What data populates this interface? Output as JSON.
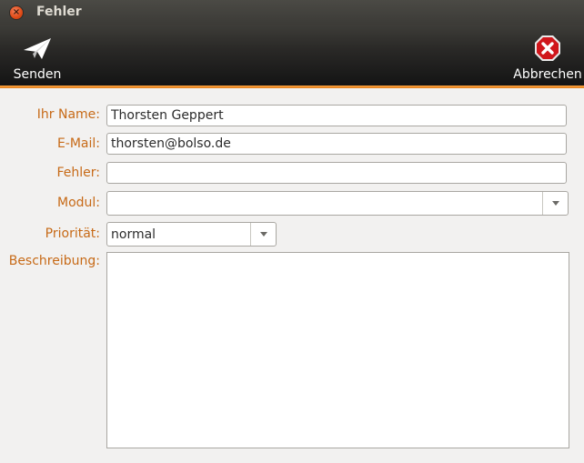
{
  "window": {
    "title": "Fehler"
  },
  "toolbar": {
    "send_label": "Senden",
    "cancel_label": "Abbrechen",
    "accent_color": "#e4801c"
  },
  "form": {
    "name": {
      "label": "Ihr Name:",
      "value": "Thorsten Geppert"
    },
    "email": {
      "label": "E-Mail:",
      "value": "thorsten@bolso.de"
    },
    "error": {
      "label": "Fehler:",
      "value": ""
    },
    "module": {
      "label": "Modul:",
      "value": ""
    },
    "priority": {
      "label": "Priorität:",
      "value": "normal"
    },
    "description": {
      "label": "Beschreibung:",
      "value": ""
    }
  },
  "icons": {
    "close": "close-icon",
    "send": "paper-plane-icon",
    "cancel": "cancel-icon"
  }
}
